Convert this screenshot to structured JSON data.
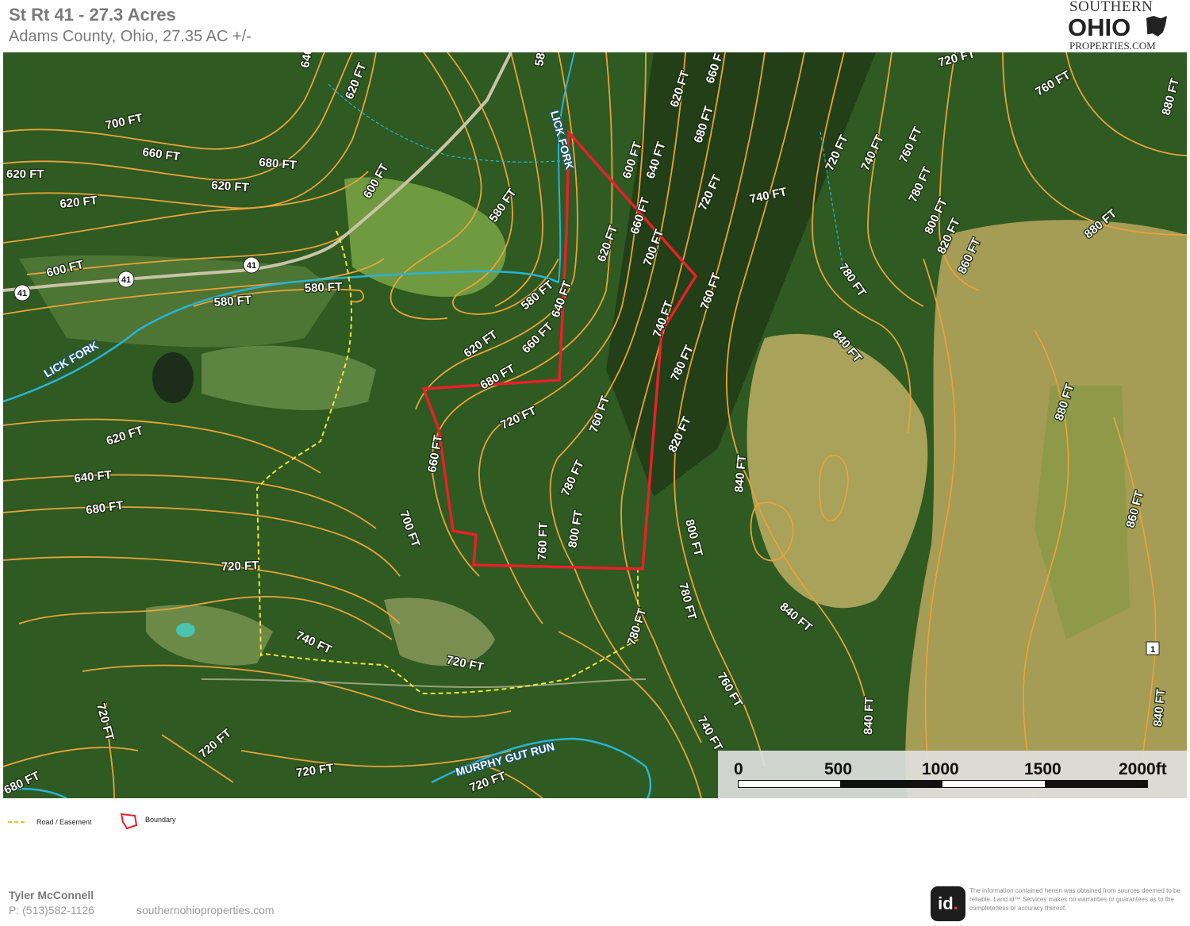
{
  "header": {
    "title": "St Rt 41 - 27.3 Acres",
    "subtitle": "Adams County, Ohio, 27.35 AC +/-"
  },
  "logo": {
    "line1": "SOUTHERN",
    "line2": "OHIO",
    "line3": "PROPERTIES.COM"
  },
  "map": {
    "contour_labels": [
      "580 FT",
      "600 FT",
      "620 FT",
      "640 FT",
      "660 FT",
      "680 FT",
      "700 FT",
      "720 FT",
      "740 FT",
      "760 FT",
      "780 FT",
      "800 FT",
      "820 FT",
      "840 FT",
      "860 FT",
      "880 FT"
    ],
    "water_labels": [
      "LICK FORK",
      "MURPHY GUT RUN"
    ],
    "route_markers": [
      "41",
      "1"
    ],
    "colors": {
      "contour": "#e8a33a",
      "boundary": "#e8202a",
      "road_easement": "#f2e23a",
      "stream": "#2ab3d4",
      "forest": "#2f5a22",
      "field": "#a8a25a"
    }
  },
  "scale": {
    "ticks": [
      "0",
      "500",
      "1000",
      "1500",
      "2000ft"
    ]
  },
  "legend": {
    "road_label": "Road / Easement",
    "boundary_label": "Boundary"
  },
  "footer": {
    "agent_name": "Tyler McConnell",
    "phone": "P: (513)582-1126",
    "website": "southernohioproperties.com",
    "id_logo": "id",
    "disclaimer": "The information contained herein was obtained from sources deemed to be reliable. Land id™ Services makes no warranties or guarantees as to the completeness or accuracy thereof."
  }
}
